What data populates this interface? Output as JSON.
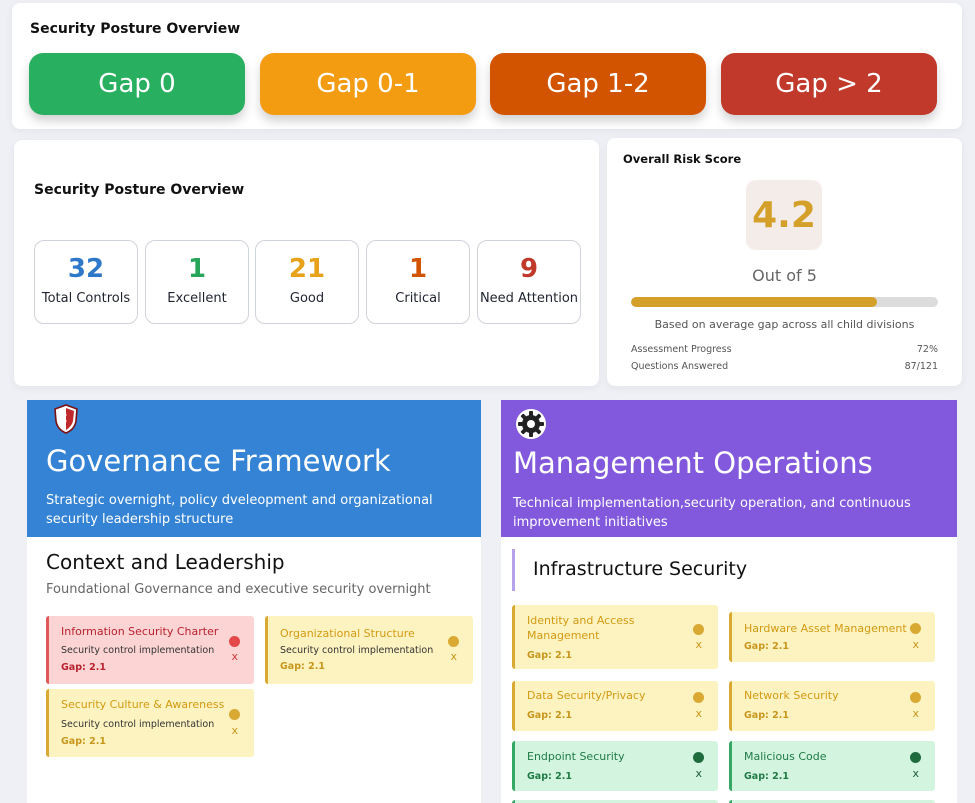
{
  "legend": {
    "title": "Security Posture Overview",
    "items": [
      {
        "label": "Gap 0",
        "color": "#28b060"
      },
      {
        "label": "Gap 0-1",
        "color": "#f39c12"
      },
      {
        "label": "Gap 1-2",
        "color": "#d35400"
      },
      {
        "label": "Gap > 2",
        "color": "#c0392b"
      }
    ]
  },
  "overview": {
    "title": "Security Posture Overview",
    "stats": [
      {
        "value": "32",
        "label": "Total Controls",
        "color": "#2f78c9"
      },
      {
        "value": "1",
        "label": "Excellent",
        "color": "#27a65a"
      },
      {
        "value": "21",
        "label": "Good",
        "color": "#e8a21a"
      },
      {
        "value": "1",
        "label": "Critical",
        "color": "#d35400"
      },
      {
        "value": "9",
        "label": "Need Attention",
        "color": "#c0392b"
      }
    ]
  },
  "risk": {
    "title": "Overall Risk Score",
    "score": "4.2",
    "out_of": "Out of 5",
    "progress": 0.8,
    "basis": "Based on average gap across all child divisions",
    "assessment_label": "Assessment Progress",
    "assessment_value": "72%",
    "questions_label": "Questions Answered",
    "questions_value": "87/121"
  },
  "governance": {
    "icon": "shield-icon",
    "color": "#3483d4",
    "title": "Governance Framework",
    "description": "Strategic overnight, policy dveleopment and organizational security leadership structure",
    "section_title": "Context and Leadership",
    "section_desc": "Foundational Governance and executive security overnight",
    "cards": [
      {
        "title": "Information Security Charter",
        "desc": "Security control implementation",
        "gap": "Gap: 2.1",
        "x": "x"
      },
      {
        "title": "Organizational Structure",
        "desc": "Security control implementation",
        "gap": "Gap: 2.1",
        "x": "x"
      },
      {
        "title": "Security Culture & Awareness",
        "desc": "Security control implementation",
        "gap": "Gap: 2.1",
        "x": "x"
      }
    ]
  },
  "management": {
    "icon": "gear-icon",
    "color": "#8259dc",
    "title": "Management Operations",
    "description": "Technical implementation,security operation, and continuous improvement initiatives",
    "section_title": "Infrastructure Security",
    "cards": [
      {
        "title": "Identity and Access Management",
        "gap": "Gap: 2.1",
        "x": "x"
      },
      {
        "title": "Hardware Asset Management",
        "gap": "Gap: 2.1",
        "x": "x"
      },
      {
        "title": "Data Security/Privacy",
        "gap": "Gap: 2.1",
        "x": "x"
      },
      {
        "title": "Network Security",
        "gap": "Gap: 2.1",
        "x": "x"
      },
      {
        "title": "Endpoint Security",
        "gap": "Gap: 2.1",
        "x": "x"
      },
      {
        "title": "Malicious Code",
        "gap": "Gap: 2.1",
        "x": "x"
      }
    ]
  }
}
